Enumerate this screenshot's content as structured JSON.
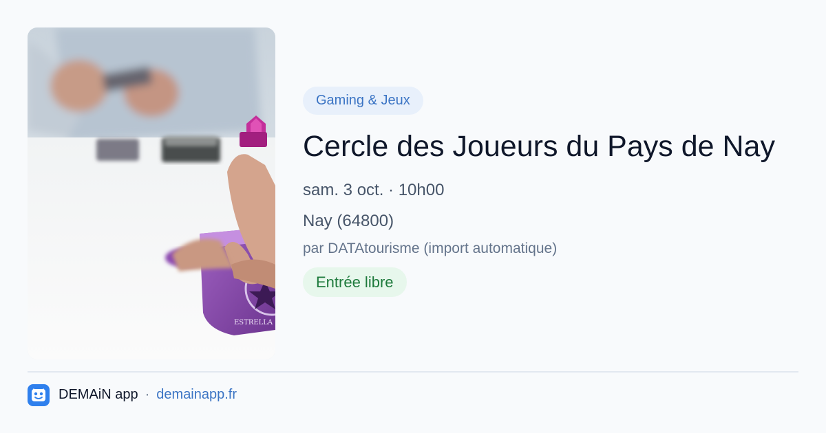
{
  "event": {
    "category": "Gaming & Jeux",
    "title": "Cercle des Joueurs du Pays de Nay",
    "date_time": "sam. 3 oct. · 10h00",
    "location": "Nay (64800)",
    "organizer": "par DATAtourisme (import automatique)",
    "price": "Entrée libre",
    "photo_box_text": "ESTRELLA"
  },
  "footer": {
    "app_name": "DEMAiN app",
    "separator": "·",
    "url": "demainapp.fr"
  },
  "colors": {
    "category_bg": "#e8f0fb",
    "category_text": "#3b74c4",
    "price_bg": "#e7f7ec",
    "price_text": "#1e7a3c",
    "app_icon": "#2f80ed",
    "link": "#3b74c4"
  }
}
